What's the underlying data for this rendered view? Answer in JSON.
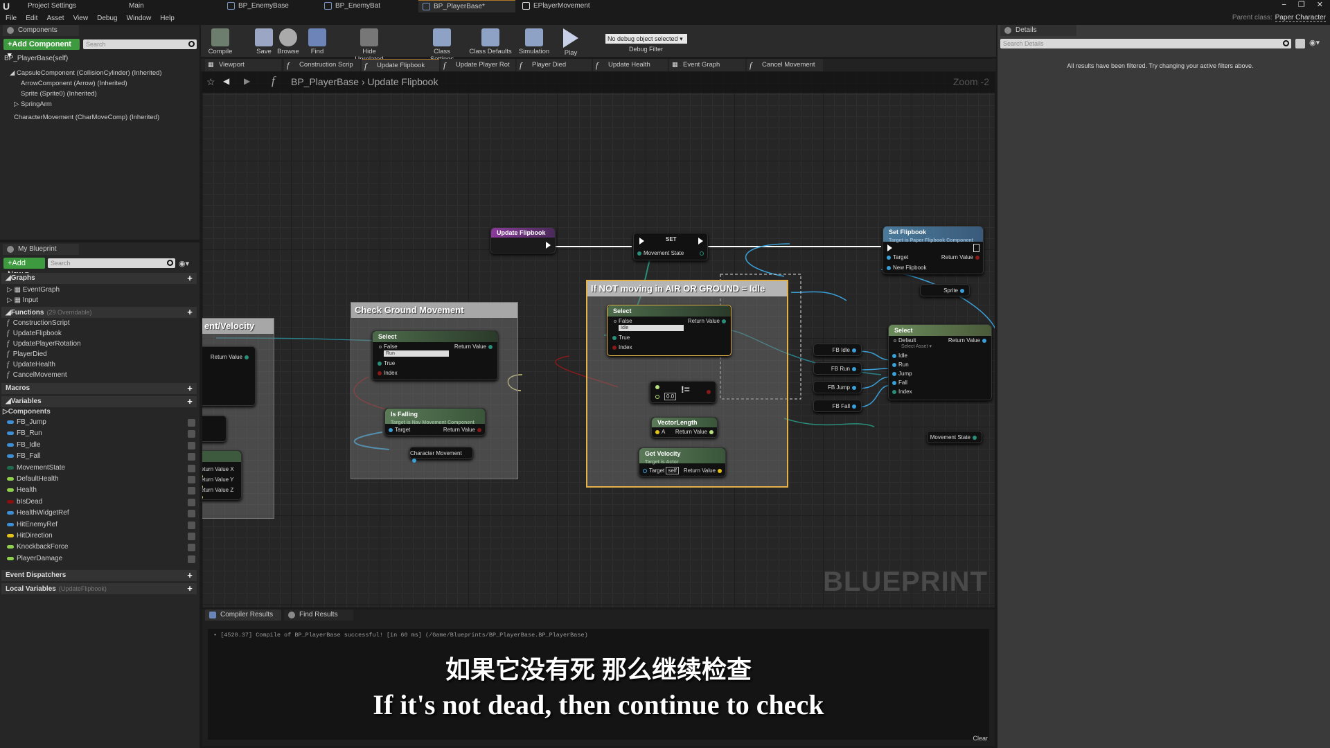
{
  "title_bar": {
    "project_settings": "Project Settings",
    "main": "Main",
    "doc_tabs": [
      "BP_EnemyBase",
      "BP_EnemyBat",
      "BP_PlayerBase*",
      "EPlayerMovement"
    ],
    "parent_class_label": "Parent class:",
    "parent_class_value": "Paper Character",
    "window_controls": [
      "−",
      "❐",
      "✕"
    ]
  },
  "menu": [
    "File",
    "Edit",
    "Asset",
    "View",
    "Debug",
    "Window",
    "Help"
  ],
  "components_panel": {
    "tab": "Components",
    "add_button": "+Add Component ▾",
    "search_placeholder": "Search",
    "self": "BP_PlayerBase(self)",
    "tree": [
      "CapsuleComponent (CollisionCylinder) (Inherited)",
      "ArrowComponent (Arrow) (Inherited)",
      "Sprite (Sprite0) (Inherited)",
      "SpringArm",
      "CharacterMovement (CharMoveComp) (Inherited)"
    ]
  },
  "my_blueprint": {
    "tab": "My Blueprint",
    "add_button": "+Add New ▾",
    "search_placeholder": "Search",
    "graphs_label": "Graphs",
    "graphs": [
      "EventGraph",
      "Input"
    ],
    "functions_label": "Functions",
    "functions_sub": "(29 Overridable)",
    "functions": [
      "ConstructionScript",
      "UpdateFlipbook",
      "UpdatePlayerRotation",
      "PlayerDied",
      "UpdateHealth",
      "CancelMovement"
    ],
    "macros_label": "Macros",
    "variables_label": "Variables",
    "components_label": "Components",
    "variables": [
      {
        "name": "FB_Jump",
        "color": "#3d8fd6"
      },
      {
        "name": "FB_Run",
        "color": "#3d8fd6"
      },
      {
        "name": "FB_Idle",
        "color": "#3d8fd6"
      },
      {
        "name": "FB_Fall",
        "color": "#3d8fd6"
      },
      {
        "name": "MovementState",
        "color": "#1e6b4e"
      },
      {
        "name": "DefaultHealth",
        "color": "#8fd14f"
      },
      {
        "name": "Health",
        "color": "#8fd14f"
      },
      {
        "name": "bIsDead",
        "color": "#8a1010"
      },
      {
        "name": "HealthWidgetRef",
        "color": "#3d8fd6"
      },
      {
        "name": "HitEnemyRef",
        "color": "#3d8fd6"
      },
      {
        "name": "HitDirection",
        "color": "#e3c21a"
      },
      {
        "name": "KnockbackForce",
        "color": "#8fd14f"
      },
      {
        "name": "PlayerDamage",
        "color": "#8fd14f"
      }
    ],
    "event_dispatchers_label": "Event Dispatchers",
    "local_variables_label": "Local Variables",
    "local_variables_sub": "(UpdateFlipbook)"
  },
  "toolbar": {
    "buttons": [
      "Compile",
      "Save",
      "Browse",
      "Find",
      "Hide Unrelated",
      "Class Settings",
      "Class Defaults",
      "Simulation",
      "Play"
    ],
    "debug_select": "No debug object selected ▾",
    "debug_filter": "Debug Filter"
  },
  "graph_tabs": [
    "Viewport",
    "Construction Scrip",
    "Update Flipbook",
    "Update Player Rot",
    "Player Died",
    "Update Health",
    "Event Graph",
    "Cancel Movement"
  ],
  "breadcrumb": {
    "root": "BP_PlayerBase",
    "sep": "›",
    "current": "Update Flipbook"
  },
  "graph": {
    "zoom": "Zoom -2",
    "watermark": "BLUEPRINT",
    "comments": {
      "velocity": "ent/Velocity",
      "ground": "Check Ground Movement",
      "idle": "If NOT moving in AIR OR GROUND = Idle"
    },
    "nodes": {
      "entry": "Update Flipbook",
      "set": {
        "title": "SET",
        "pin": "Movement State"
      },
      "set_flipbook": {
        "title": "Set Flipbook",
        "sub": "Target is Paper Flipbook Component",
        "pins": [
          "Target",
          "New Flipbook"
        ],
        "return": "Return Value"
      },
      "sprite": "Sprite",
      "select_ground": {
        "title": "Select",
        "false": "False",
        "false_value": "Run",
        "true": "True",
        "index": "Index",
        "return": "Return Value"
      },
      "is_falling": {
        "title": "Is Falling",
        "sub": "Target is Nav Movement Component",
        "target": "Target",
        "return": "Return Value"
      },
      "char_movement": "Character Movement",
      "select_idle": {
        "title": "Select",
        "false": "False",
        "false_value": "Idle",
        "true": "True",
        "index": "Index",
        "return": "Return Value"
      },
      "not_equal": {
        "op": "!=",
        "value": "0.0"
      },
      "vector_length": {
        "title": "VectorLength",
        "a": "A",
        "return": "Return Value"
      },
      "get_velocity": {
        "title": "Get Velocity",
        "sub": "Target is Actor",
        "target": "Target",
        "self": "self",
        "return": "Return Value"
      },
      "select_flipbook": {
        "title": "Select",
        "default": "Default",
        "default_value": "Select Asset ▾",
        "pins": [
          "Idle",
          "Run",
          "Jump",
          "Fall",
          "Index"
        ],
        "return": "Return Value"
      },
      "fb_getters": [
        "FB Idle",
        "FB Run",
        "FB Jump",
        "FB Fall"
      ],
      "movement_state": "Movement State",
      "velocity_pins": [
        "Return Value",
        "Return Value X",
        "Return Value Y",
        "Return Value Z"
      ]
    }
  },
  "output": {
    "tabs": [
      "Compiler Results",
      "Find Results"
    ],
    "log": "• [4520.37] Compile of BP_PlayerBase successful! [in 60 ms] (/Game/Blueprints/BP_PlayerBase.BP_PlayerBase)",
    "clear": "Clear"
  },
  "details": {
    "tab": "Details",
    "search_placeholder": "Search Details",
    "message": "All results have been filtered. Try changing your active filters above."
  },
  "subtitle": {
    "zh": "如果它没有死 那么继续检查",
    "en": "If it's not dead, then continue to check"
  }
}
